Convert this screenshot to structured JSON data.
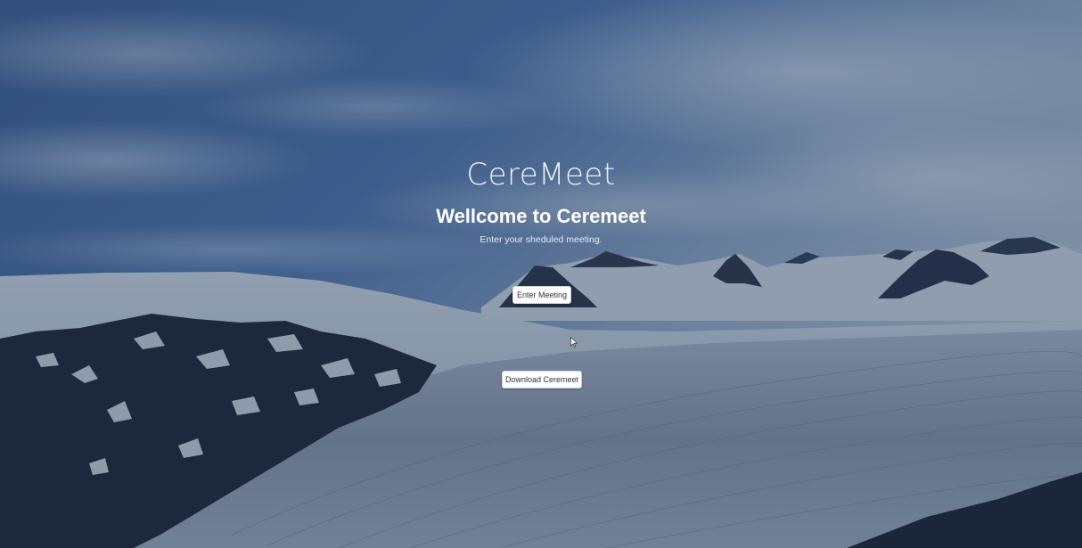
{
  "hero": {
    "brand": "CereMeet",
    "welcome": "Wellcome to Ceremeet",
    "subtitle": "Enter your sheduled meeting."
  },
  "actions": {
    "enter_meeting_label": "Enter Meeting",
    "download_label": "Download Ceremeet"
  },
  "background": {
    "description_icon": "mountain-glacier-image",
    "overlay_color": "#1c2e4a"
  }
}
